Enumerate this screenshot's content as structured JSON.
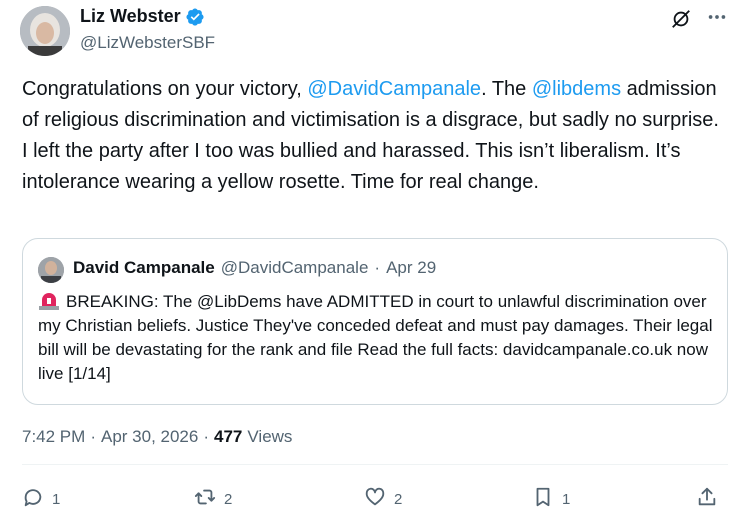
{
  "author": {
    "display_name": "Liz Webster",
    "handle": "@LizWebsterSBF",
    "verified_icon": "verified-badge-icon",
    "badge_color": "#1d9bf0"
  },
  "tweet": {
    "segments": [
      {
        "text": "Congratulations on your victory, ",
        "mention": false
      },
      {
        "text": "@DavidCampanale",
        "mention": true
      },
      {
        "text": ". The ",
        "mention": false
      },
      {
        "text": "@libdems",
        "mention": true
      },
      {
        "text": " admission of religious discrimination and victimisation is a disgrace, but sadly no surprise. I left the party after I too was bullied and harassed. This isn’t liberalism. It’s intolerance wearing a yellow rosette. Time for real change.",
        "mention": false
      }
    ]
  },
  "quote": {
    "name": "David Campanale",
    "handle": "@DavidCampanale",
    "separator": "·",
    "date": "Apr 29",
    "emoji_icon": "siren-icon",
    "text": "BREAKING: The @LibDems have ADMITTED in court to unlawful discrimination over my Christian beliefs. Justice They've conceded defeat and must pay damages. Their legal bill will be devastating for the rank and file Read the full facts: davidcampanale.co.uk now live [1/14]"
  },
  "meta": {
    "time": "7:42 PM",
    "separator": "·",
    "date": "Apr 30, 2026",
    "separator2": "·",
    "views_count": "477",
    "views_label": "Views"
  },
  "actions": {
    "replies": "1",
    "reposts": "2",
    "likes": "2",
    "bookmarks": "1"
  },
  "colors": {
    "link": "#1d9bf0",
    "secondary_text": "#536471",
    "border": "#cfd9de"
  }
}
